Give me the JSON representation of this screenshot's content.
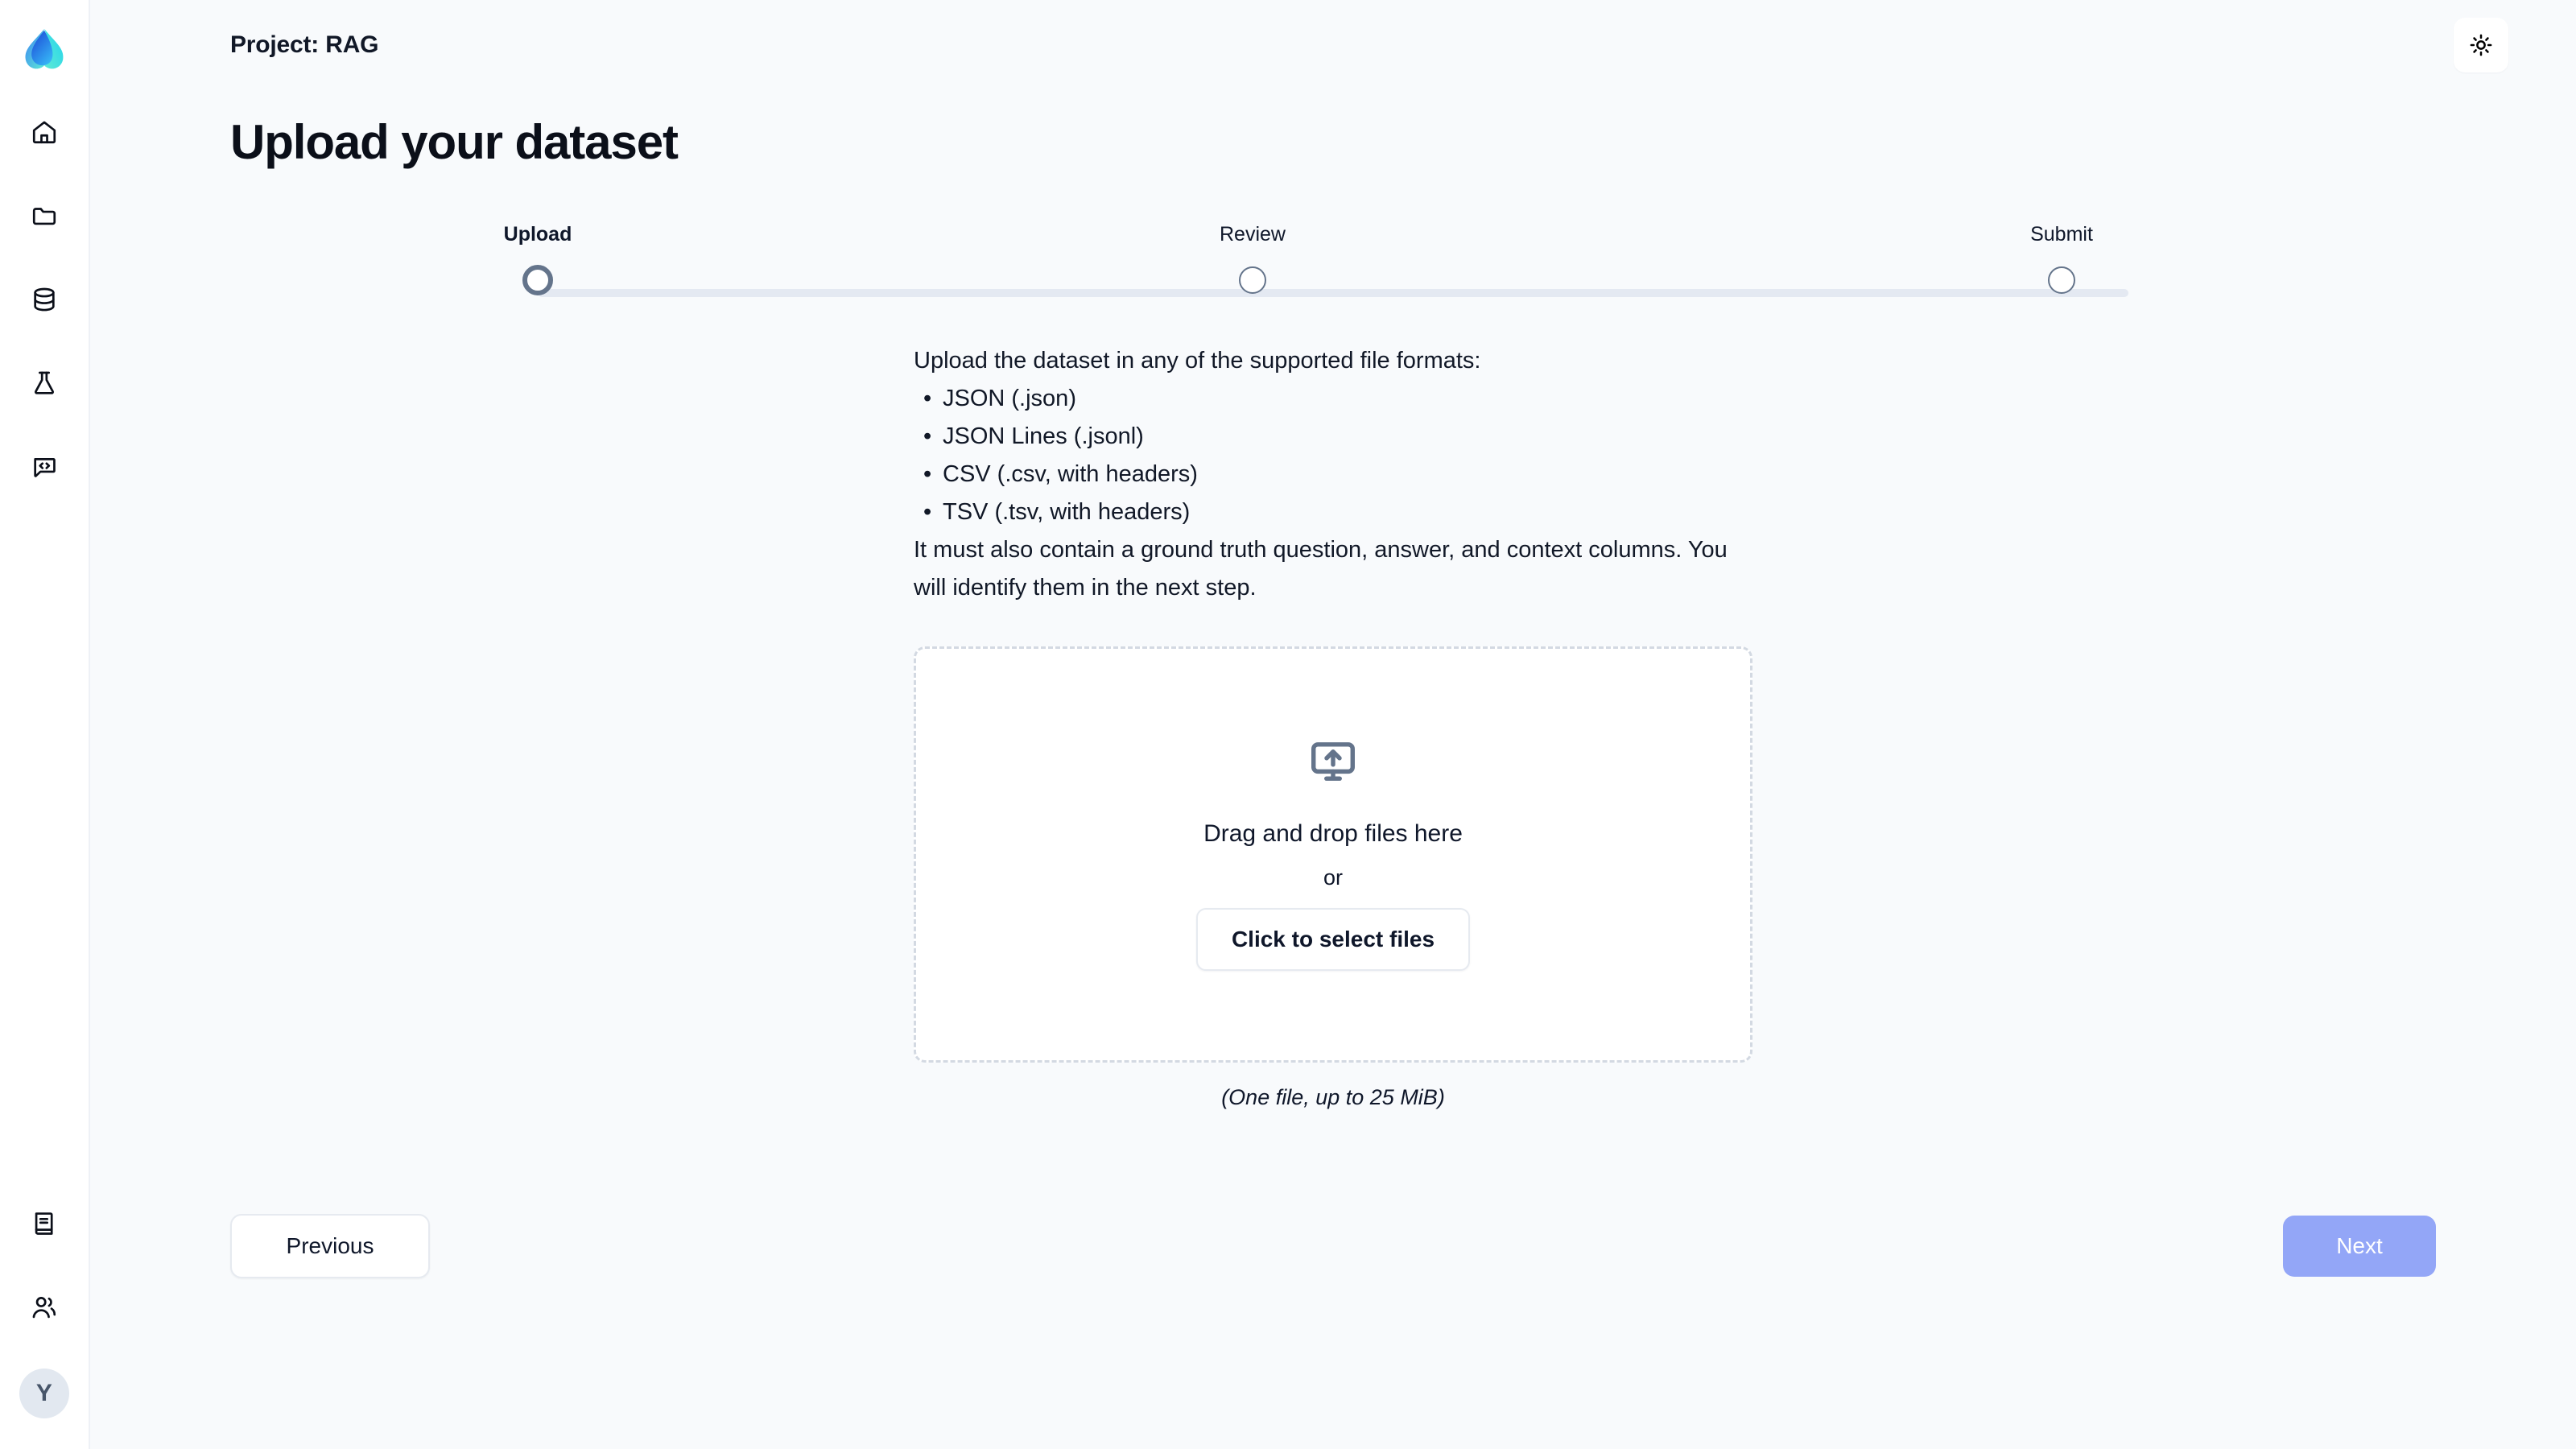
{
  "brand": {
    "logo_icon": "droplet-leaf-logo",
    "gradient_from": "#2563eb",
    "gradient_to": "#5eead4"
  },
  "sidebar": {
    "top_items": [
      {
        "icon": "home-icon",
        "name": "sidebar-item-home"
      },
      {
        "icon": "folder-icon",
        "name": "sidebar-item-projects"
      },
      {
        "icon": "database-icon",
        "name": "sidebar-item-datasets"
      },
      {
        "icon": "flask-icon",
        "name": "sidebar-item-experiments"
      },
      {
        "icon": "code-chat-icon",
        "name": "sidebar-item-prompts"
      }
    ],
    "bottom_items": [
      {
        "icon": "book-icon",
        "name": "sidebar-item-docs"
      },
      {
        "icon": "users-icon",
        "name": "sidebar-item-team"
      }
    ],
    "avatar_initial": "Y"
  },
  "header": {
    "project_title": "Project: RAG",
    "theme_toggle_icon": "sun-icon"
  },
  "page": {
    "title": "Upload your dataset"
  },
  "stepper": {
    "active_index": 0,
    "steps": [
      {
        "label": "Upload"
      },
      {
        "label": "Review"
      },
      {
        "label": "Submit"
      }
    ]
  },
  "instructions": {
    "lead": "Upload the dataset in any of the supported file formats:",
    "formats": [
      "JSON (.json)",
      "JSON Lines (.jsonl)",
      "CSV (.csv, with headers)",
      "TSV (.tsv, with headers)"
    ],
    "tail": "It must also contain a ground truth question, answer, and context columns. You will identify them in the next step."
  },
  "dropzone": {
    "icon": "monitor-upload-icon",
    "primary_text": "Drag and drop files here",
    "or_text": "or",
    "button_label": "Click to select files",
    "note": "(One file, up to 25 MiB)"
  },
  "footer": {
    "previous_label": "Previous",
    "next_label": "Next",
    "next_color": "#93a6f7"
  }
}
